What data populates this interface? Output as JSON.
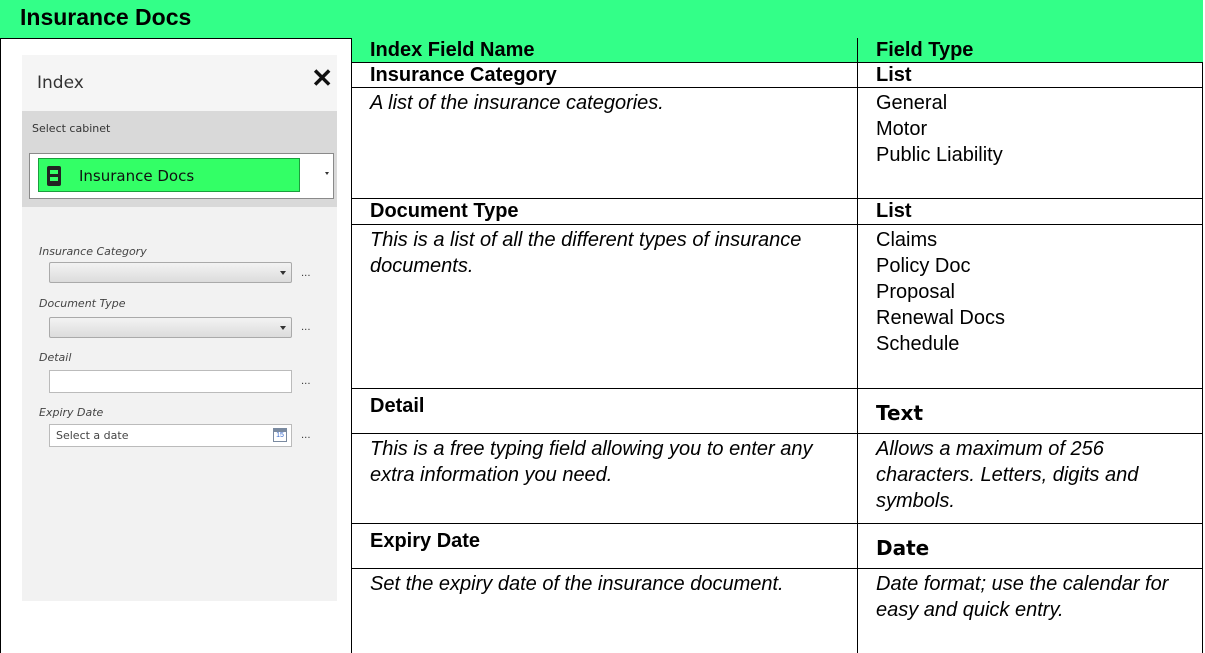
{
  "title": "Insurance Docs",
  "panel": {
    "title": "Index",
    "close_icon": "close-icon",
    "select_cabinet_label": "Select cabinet",
    "cabinet_value": "Insurance Docs",
    "cabinet_icon": "cabinet-icon",
    "fields": {
      "insurance_category": "Insurance Category",
      "document_type": "Document Type",
      "detail": "Detail",
      "expiry_date": "Expiry Date"
    },
    "date_placeholder": "Select a date",
    "calendar_icon_text": "15",
    "ellipsis": "..."
  },
  "table": {
    "header_field_name": "Index Field Name",
    "header_field_type": "Field Type",
    "rows": [
      {
        "name": "Insurance Category",
        "type": "List",
        "description": "A list of the insurance categories.",
        "options": [
          "General",
          "Motor",
          "Public Liability"
        ]
      },
      {
        "name": "Document Type",
        "type": "List",
        "description": "This is a list of all the different types of insurance documents.",
        "options": [
          "Claims",
          "Policy Doc",
          "Proposal",
          "Renewal Docs",
          "Schedule"
        ]
      },
      {
        "name": "Detail",
        "type": "Text",
        "description": "This is a free typing field allowing you to enter any extra information you need.",
        "type_note": "Allows a maximum of 256 characters. Letters, digits and symbols."
      },
      {
        "name": "Expiry Date",
        "type": "Date",
        "description": "Set the expiry date of the insurance document.",
        "type_note": "Date format; use the calendar for easy and quick entry."
      }
    ]
  },
  "colors": {
    "accent_green": "#33ff88",
    "cabinet_green": "#33ff66"
  }
}
